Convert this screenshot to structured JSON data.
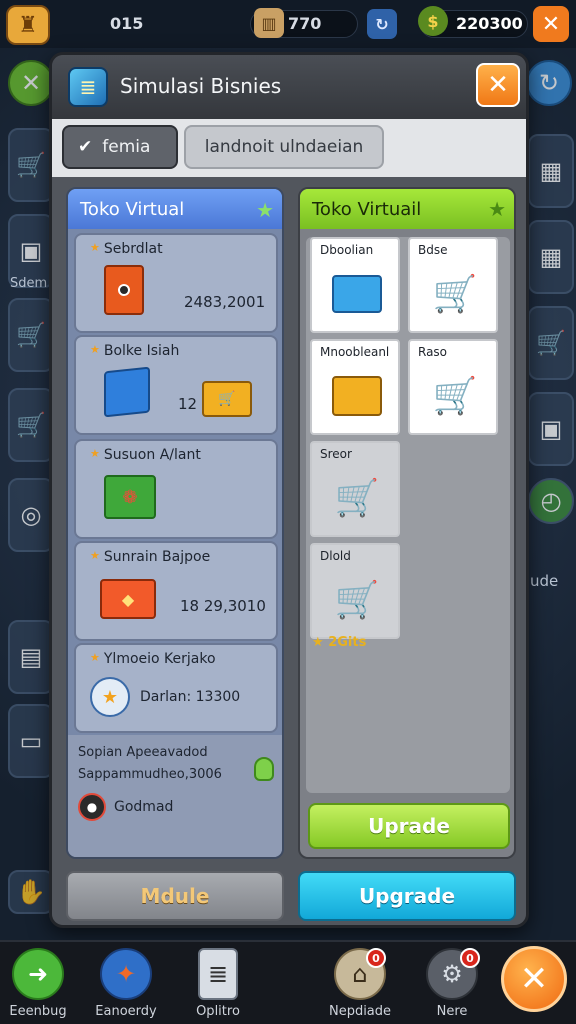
{
  "topbar": {
    "level": "015",
    "currency1": "770",
    "currency2": "220300",
    "icons": [
      "castle-icon",
      "gift-bucket-icon",
      "refresh-icon",
      "money-bag-icon",
      "close-icon"
    ]
  },
  "background": {
    "side_label_left": "Sdem",
    "side_label_right": "ude"
  },
  "modal": {
    "title": "Simulasi Bisnies",
    "tabs": [
      {
        "label": "femia",
        "active": true
      },
      {
        "label": "landnoit ulndaeian",
        "active": false
      }
    ],
    "left_panel": {
      "title": "Toko Virtual",
      "items": [
        {
          "title": "Sebrdlat",
          "value": "2483,2001",
          "icon": "orange-box-icon"
        },
        {
          "title": "Bolke Isiah",
          "value": "12",
          "icon": "blue-cube-icon"
        },
        {
          "title": "Susuon A/lant",
          "value": "",
          "icon": "vegetable-crate-icon"
        },
        {
          "title": "Sunrain Bajpoe",
          "value": "18 29,3010",
          "icon": "fruit-box-icon"
        },
        {
          "title": "Ylmoeio Kerjako",
          "value": "Darlan: 13300",
          "icon": "stamp-badge-icon"
        }
      ],
      "footer": {
        "line1": "Sopian Apeeavadod",
        "line2": "Sappammudheo,3006",
        "label": "Godmad"
      }
    },
    "right_panel": {
      "title": "Toko Virtuail",
      "cells": [
        {
          "label": "Dboolian",
          "icon": "blue-basket-icon"
        },
        {
          "label": "Bdse",
          "icon": "red-cart-icon"
        },
        {
          "label": "Mnoobleanl",
          "icon": "yellow-crate-icon"
        },
        {
          "label": "Raso",
          "icon": "purple-cart-icon"
        },
        {
          "label": "Sreor",
          "icon": "fruit-cart-icon"
        },
        {
          "label": "Dlold",
          "icon": "veg-cart-icon"
        }
      ],
      "bonus": "2Gits",
      "upgrade_label": "Uprade"
    },
    "buttons": {
      "left": "Mdule",
      "right": "Upgrade"
    }
  },
  "bottom_nav": [
    {
      "label": "Eeenbug",
      "icon": "arrow-icon",
      "badge": ""
    },
    {
      "label": "Eanoerdy",
      "icon": "compass-icon",
      "badge": ""
    },
    {
      "label": "Oplitro",
      "icon": "document-icon",
      "badge": ""
    },
    {
      "label": "Nepdiade",
      "icon": "hat-icon",
      "badge": "0"
    },
    {
      "label": "Nere",
      "icon": "gear-icon",
      "badge": "0"
    }
  ],
  "colors": {
    "accent_orange": "#f07816",
    "left_header": "#4b78d6",
    "right_header": "#86c926",
    "upgrade_blue": "#12a8d8",
    "value_red": "#d8261c"
  }
}
